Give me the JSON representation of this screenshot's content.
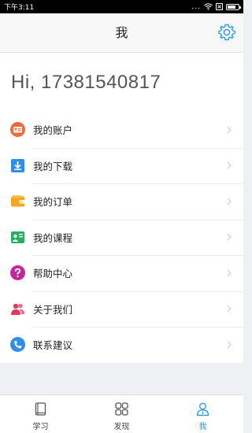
{
  "status_bar": {
    "time": "下午3:11",
    "dots": "...",
    "battery_level": 0.8
  },
  "header": {
    "title": "我"
  },
  "greeting": "Hi, 17381540817",
  "menu": [
    {
      "label": "我的账户",
      "icon": "account-card-icon",
      "color": "#f06a3a"
    },
    {
      "label": "我的下载",
      "icon": "download-icon",
      "color": "#2f8fe6"
    },
    {
      "label": "我的订单",
      "icon": "wallet-icon",
      "color": "#f5a623"
    },
    {
      "label": "我的课程",
      "icon": "course-icon",
      "color": "#27ae60"
    },
    {
      "label": "帮助中心",
      "icon": "help-icon",
      "color": "#c2279e"
    },
    {
      "label": "关于我们",
      "icon": "people-icon",
      "color": "#e23a5a"
    },
    {
      "label": "联系建议",
      "icon": "phone-icon",
      "color": "#2f8fe6"
    }
  ],
  "tabs": [
    {
      "label": "学习",
      "icon": "book-icon",
      "active": false
    },
    {
      "label": "发现",
      "icon": "grid-icon",
      "active": false
    },
    {
      "label": "我",
      "icon": "person-icon",
      "active": true
    }
  ],
  "colors": {
    "accent": "#2a9be0",
    "background": "#eef0f3"
  }
}
